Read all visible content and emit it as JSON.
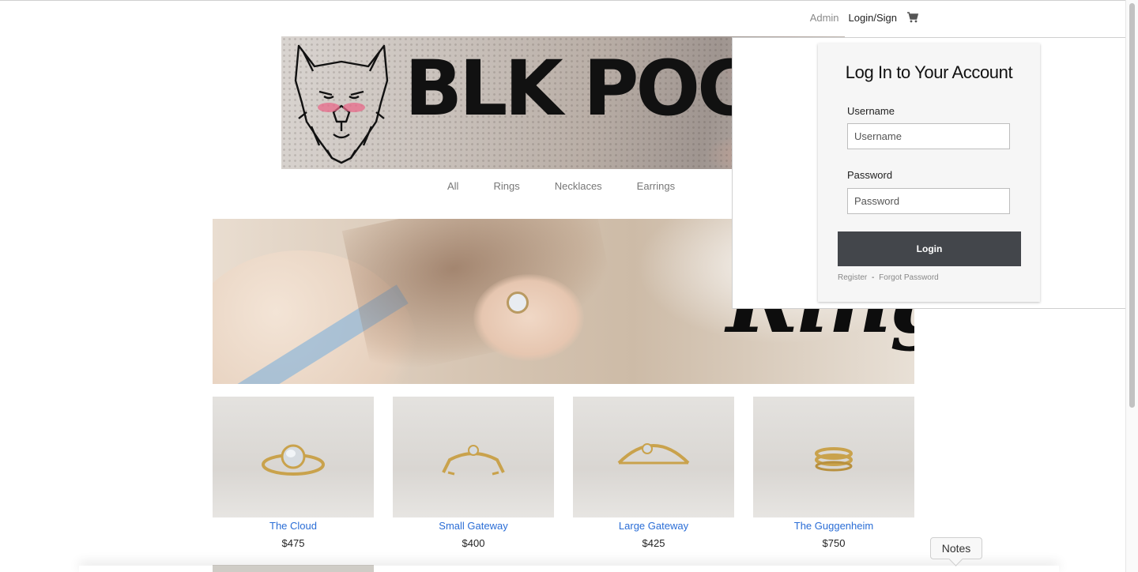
{
  "topnav": {
    "admin_label": "Admin",
    "login_label": "Login/Sign",
    "cart_icon": "shopping-cart-icon"
  },
  "banner": {
    "brand": "BLK POCKI",
    "logo_icon": "wolf-head-logo"
  },
  "categories": [
    {
      "label": "All"
    },
    {
      "label": "Rings"
    },
    {
      "label": "Necklaces"
    },
    {
      "label": "Earrings"
    }
  ],
  "hero": {
    "title": "Rings"
  },
  "products": [
    {
      "name": "The Cloud",
      "price": "$475"
    },
    {
      "name": "Small Gateway",
      "price": "$400"
    },
    {
      "name": "Large Gateway",
      "price": "$425"
    },
    {
      "name": "The Guggenheim",
      "price": "$750"
    }
  ],
  "login": {
    "title": "Log In to Your Account",
    "username_label": "Username",
    "username_placeholder": "Username",
    "password_label": "Password",
    "password_placeholder": "Password",
    "button_label": "Login",
    "register_label": "Register",
    "separator": "-",
    "forgot_label": "Forgot Password"
  },
  "notes": {
    "label": "Notes"
  },
  "colors": {
    "link": "#2a6dd6",
    "button": "#43464b"
  }
}
